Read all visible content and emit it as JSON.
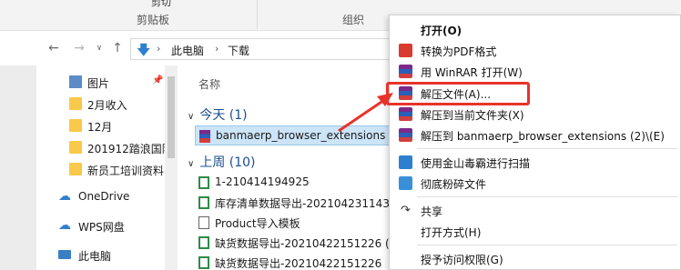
{
  "ribbon": {
    "clipped_top_label": "剪切",
    "group_clipboard": "剪贴板",
    "group_organize": "组织"
  },
  "address": {
    "back_icon": "arrow-left-icon",
    "forward_icon": "arrow-right-icon",
    "recent_icon": "chevron-down-icon",
    "up_icon": "arrow-up-icon",
    "crumbs": [
      "此电脑",
      "下载"
    ]
  },
  "nav": {
    "items": [
      {
        "label": "图片",
        "icon": "pictures-folder-icon"
      },
      {
        "label": "2月收入",
        "icon": "folder-icon"
      },
      {
        "label": "12月",
        "icon": "folder-icon"
      },
      {
        "label": "201912踏浪国际",
        "icon": "folder-icon"
      },
      {
        "label": "新员工培训资料",
        "icon": "folder-icon"
      },
      {
        "label": "OneDrive",
        "icon": "cloud-icon"
      },
      {
        "label": "WPS网盘",
        "icon": "wps-cloud-icon"
      },
      {
        "label": "此电脑",
        "icon": "computer-icon"
      }
    ]
  },
  "list": {
    "column_name": "名称",
    "group_today": "今天 (1)",
    "group_last_week": "上周 (10)",
    "files_today": [
      {
        "name": "banmaerp_browser_extensions (2",
        "icon": "rar-icon"
      }
    ],
    "files_last_week": [
      {
        "name": "1-210414194925",
        "icon": "excel-icon"
      },
      {
        "name": "库存清单数据导出-202104231143",
        "icon": "excel-icon"
      },
      {
        "name": "Product导入模板",
        "icon": "document-icon"
      },
      {
        "name": "缺货数据导出-20210422151226 (1",
        "icon": "excel-icon"
      },
      {
        "name": "缺货数据导出-20210422151226",
        "icon": "excel-icon"
      }
    ]
  },
  "context_menu": {
    "items": [
      {
        "label": "打开(O)",
        "icon": "",
        "bold": true
      },
      {
        "label": "转换为PDF格式",
        "icon": "pdf-icon"
      },
      {
        "label": "用 WinRAR 打开(W)",
        "icon": "winrar-icon"
      },
      {
        "label": "解压文件(A)...",
        "icon": "winrar-icon"
      },
      {
        "label": "解压到当前文件夹(X)",
        "icon": "winrar-icon"
      },
      {
        "label": "解压到 banmaerp_browser_extensions (2)\\(E)",
        "icon": "winrar-icon"
      },
      {
        "label": "使用金山毒霸进行扫描",
        "icon": "shield-icon"
      },
      {
        "label": "彻底粉碎文件",
        "icon": "shred-icon"
      },
      {
        "label": "共享",
        "icon": "share-icon"
      },
      {
        "label": "打开方式(H)",
        "icon": ""
      },
      {
        "label": "授予访问权限(G)",
        "icon": ""
      }
    ]
  },
  "colors": {
    "highlight": "#e8332a",
    "selection": "#cce4f7",
    "accent": "#1a4f8c"
  }
}
